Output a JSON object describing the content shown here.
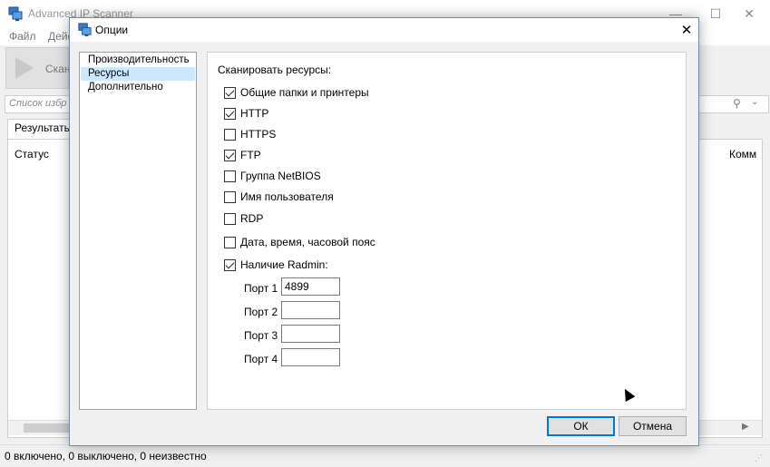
{
  "main_window": {
    "title": "Advanced IP Scanner",
    "menu": [
      "Файл",
      "Дейс"
    ],
    "scan_label": "Скан",
    "favorites_placeholder": "Список избр",
    "tab_label": "Результаты",
    "columns": {
      "status": "Статус",
      "comment": "Комм"
    },
    "statusbar": "0 включено, 0 выключено, 0 неизвестно"
  },
  "dialog": {
    "title": "Опции",
    "nav": [
      {
        "label": "Производительность",
        "selected": false
      },
      {
        "label": "Ресурсы",
        "selected": true
      },
      {
        "label": "Дополнительно",
        "selected": false
      }
    ],
    "section_title": "Сканировать ресурсы:",
    "options": [
      {
        "label": "Общие папки и принтеры",
        "checked": true
      },
      {
        "label": "HTTP",
        "checked": true
      },
      {
        "label": "HTTPS",
        "checked": false
      },
      {
        "label": "FTP",
        "checked": true
      },
      {
        "label": "Группа NetBIOS",
        "checked": false
      },
      {
        "label": "Имя пользователя",
        "checked": false
      },
      {
        "label": "RDP",
        "checked": false
      },
      {
        "label": "Дата, время, часовой пояс",
        "checked": false
      },
      {
        "label": "Наличие Radmin:",
        "checked": true
      }
    ],
    "ports": [
      {
        "label": "Порт 1",
        "value": "4899"
      },
      {
        "label": "Порт 2",
        "value": ""
      },
      {
        "label": "Порт 3",
        "value": ""
      },
      {
        "label": "Порт 4",
        "value": ""
      }
    ],
    "buttons": {
      "ok": "ОК",
      "cancel": "Отмена"
    }
  },
  "colors": {
    "accent": "#0078d7",
    "selection": "#cce8ff",
    "dialog_border": "#6b8cb0"
  },
  "icons": {
    "app": "network-computer-icon",
    "search": "search-icon",
    "close": "close-icon"
  }
}
